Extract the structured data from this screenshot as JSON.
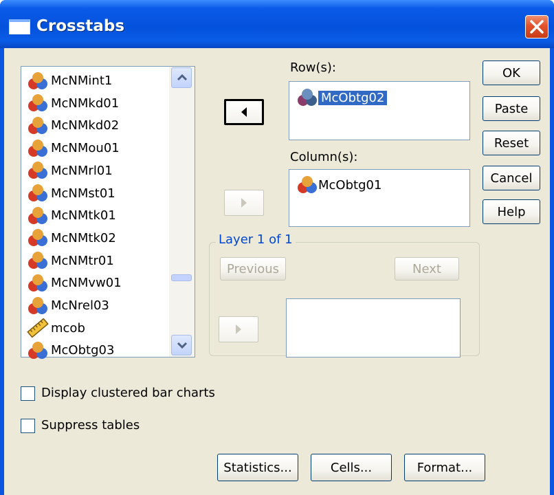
{
  "window": {
    "title": "Crosstabs"
  },
  "source_list": {
    "items": [
      {
        "label": "McNMint1",
        "icon": "nominal-icon"
      },
      {
        "label": "McNMkd01",
        "icon": "nominal-icon"
      },
      {
        "label": "McNMkd02",
        "icon": "nominal-icon"
      },
      {
        "label": "McNMou01",
        "icon": "nominal-icon"
      },
      {
        "label": "McNMrl01",
        "icon": "nominal-icon"
      },
      {
        "label": "McNMst01",
        "icon": "nominal-icon"
      },
      {
        "label": "McNMtk01",
        "icon": "nominal-icon"
      },
      {
        "label": "McNMtk02",
        "icon": "nominal-icon"
      },
      {
        "label": "McNMtr01",
        "icon": "nominal-icon"
      },
      {
        "label": "McNMvw01",
        "icon": "nominal-icon"
      },
      {
        "label": "McNrel03",
        "icon": "nominal-icon"
      },
      {
        "label": "mcob",
        "icon": "scale-ruler-icon"
      },
      {
        "label": "McObtg03",
        "icon": "nominal-icon"
      }
    ]
  },
  "rows": {
    "label": "Row(s):",
    "items": [
      "McObtg02"
    ],
    "selected": "McObtg02"
  },
  "columns": {
    "label": "Column(s):",
    "items": [
      "McObtg01"
    ]
  },
  "layer": {
    "title": "Layer 1 of 1",
    "previous": "Previous",
    "next": "Next"
  },
  "buttons": {
    "ok": "OK",
    "paste": "Paste",
    "reset": "Reset",
    "cancel": "Cancel",
    "help": "Help"
  },
  "options": {
    "clustered": {
      "label": "Display clustered bar charts",
      "checked": false
    },
    "suppress": {
      "label": "Suppress tables",
      "checked": false
    }
  },
  "bottom_buttons": {
    "statistics": "Statistics...",
    "cells": "Cells...",
    "format": "Format..."
  },
  "colors": {
    "title_bar": "#0452dc",
    "face": "#ece9d8",
    "selection": "#316ac5",
    "group_title": "#0046d5"
  }
}
